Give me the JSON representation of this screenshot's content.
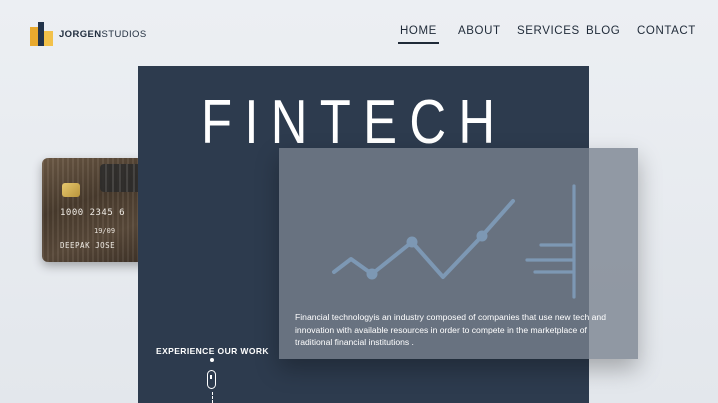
{
  "brand": {
    "name_bold": "JORGEN",
    "name_rest": "STUDIOS"
  },
  "nav": {
    "items": [
      {
        "label": "HOME",
        "active": true
      },
      {
        "label": "ABOUT",
        "active": false
      },
      {
        "label": "SERVICES",
        "active": false
      },
      {
        "label": "BLOG",
        "active": false
      },
      {
        "label": "CONTACT",
        "active": false
      }
    ]
  },
  "card": {
    "number": "1000 2345 6",
    "expiry": "19/09",
    "holder": "DEEPAK JOSE"
  },
  "hero": {
    "title": "FINTECH",
    "description": "Financial technologyis an industry composed of companies that use new tech and innovation with available resources in order to compete in the marketplace of traditional financial institutions .",
    "cta": "EXPERIENCE OUR WORK"
  },
  "colors": {
    "hero_bg": "#2d3b4e",
    "accent_line": "#7d98b4",
    "page_bg": "#e8ebef"
  },
  "icons": [
    "logo-mark-icon",
    "credit-card-chip-icon",
    "trend-line-icon",
    "bar-chart-icon",
    "mouse-scroll-icon"
  ]
}
